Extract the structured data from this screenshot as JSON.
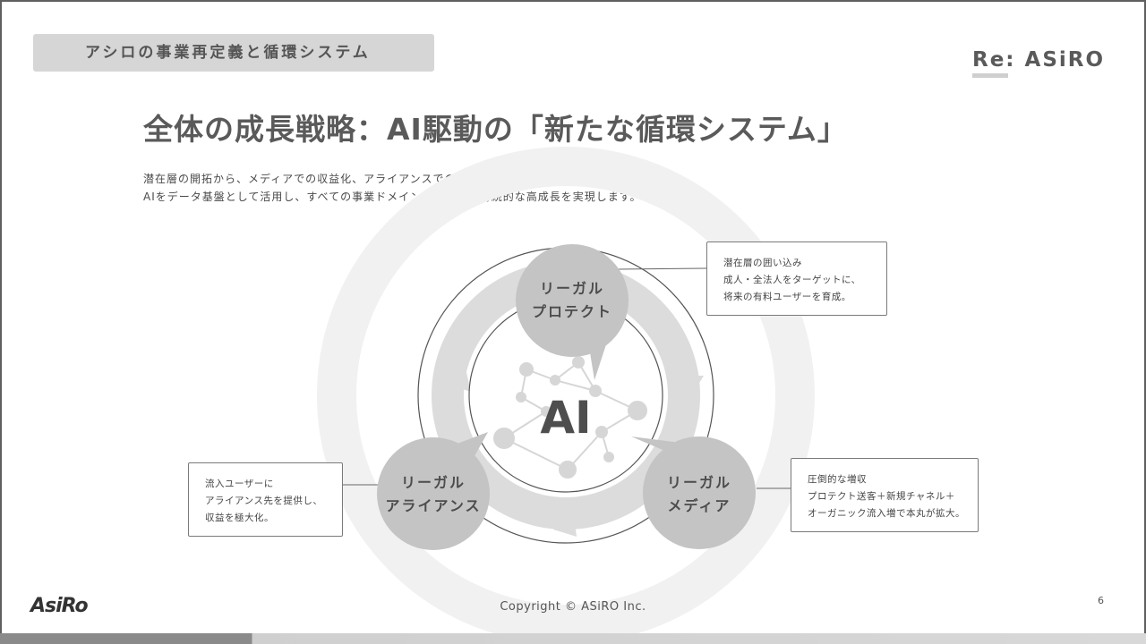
{
  "header": {
    "section_tag": "アシロの事業再定義と循環システム",
    "brand": "Re: ASiRO"
  },
  "title": "全体の成長戦略：AI駆動の「新たな循環システム」",
  "lead": [
    "潜在層の開拓から、メディアでの収益化、アライアンスでのLTV最大化まで。",
    "AIをデータ基盤として活用し、すべての事業ドメインが連動して持続的な高成長を実現します。"
  ],
  "diagram": {
    "center": "AI",
    "nodes": {
      "protect": [
        "リーガル",
        "プロテクト"
      ],
      "alliance": [
        "リーガル",
        "アライアンス"
      ],
      "media": [
        "リーガル",
        "メディア"
      ]
    },
    "callouts": {
      "protect": [
        "潜在層の囲い込み",
        "成人・全法人をターゲットに、",
        "将来の有料ユーザーを育成。"
      ],
      "alliance": [
        "流入ユーザーに",
        "アライアンス先を提供し、",
        "収益を極大化。"
      ],
      "media": [
        "圧倒的な増収",
        "プロテクト送客＋新規チャネル＋",
        "オーガニック流入増で本丸が拡大。"
      ]
    }
  },
  "footer": {
    "copyright": "Copyright © ASiRO Inc.",
    "page_number": "6",
    "logo": "AsiRo"
  },
  "colors": {
    "node_fill": "#c4c4c4",
    "ring": "#dcdcdc",
    "text": "#555555"
  }
}
